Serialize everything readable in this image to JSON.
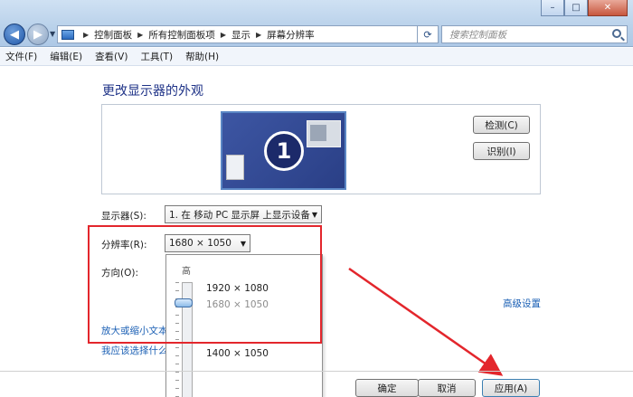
{
  "window": {
    "minimize": "–",
    "maximize": "□",
    "close": "✕"
  },
  "address_bar": {
    "breadcrumbs": [
      "控制面板",
      "所有控制面板项",
      "显示",
      "屏幕分辨率"
    ]
  },
  "search": {
    "placeholder": "搜索控制面板"
  },
  "menu": [
    "文件(F)",
    "编辑(E)",
    "查看(V)",
    "工具(T)",
    "帮助(H)"
  ],
  "main": {
    "title": "更改显示器的外观",
    "monitor_number": "1",
    "detect_button": "检测(C)",
    "identify_button": "识别(I)",
    "display_label": "显示器(S):",
    "display_value": "1. 在 移动 PC 显示屏 上显示设备",
    "resolution_label": "分辨率(R):",
    "resolution_value": "1680 × 1050",
    "orientation_label": "方向(O):",
    "advanced_link": "高级设置",
    "scale_link": "放大或缩小文本",
    "choose_link": "我应该选择什么"
  },
  "resolution_dropdown": {
    "high_label": "高",
    "options": [
      {
        "label": "1920 × 1080",
        "state": "normal"
      },
      {
        "label": "1680 × 1050",
        "state": "current"
      },
      {
        "label": "1400 × 1050",
        "state": "normal"
      }
    ]
  },
  "footer": {
    "ok_button": "确定",
    "cancel_button": "取消",
    "apply_button": "应用(A)"
  },
  "colors": {
    "annotation": "#e3262c",
    "title_text": "#1e3287",
    "link": "#1a5fb4"
  }
}
